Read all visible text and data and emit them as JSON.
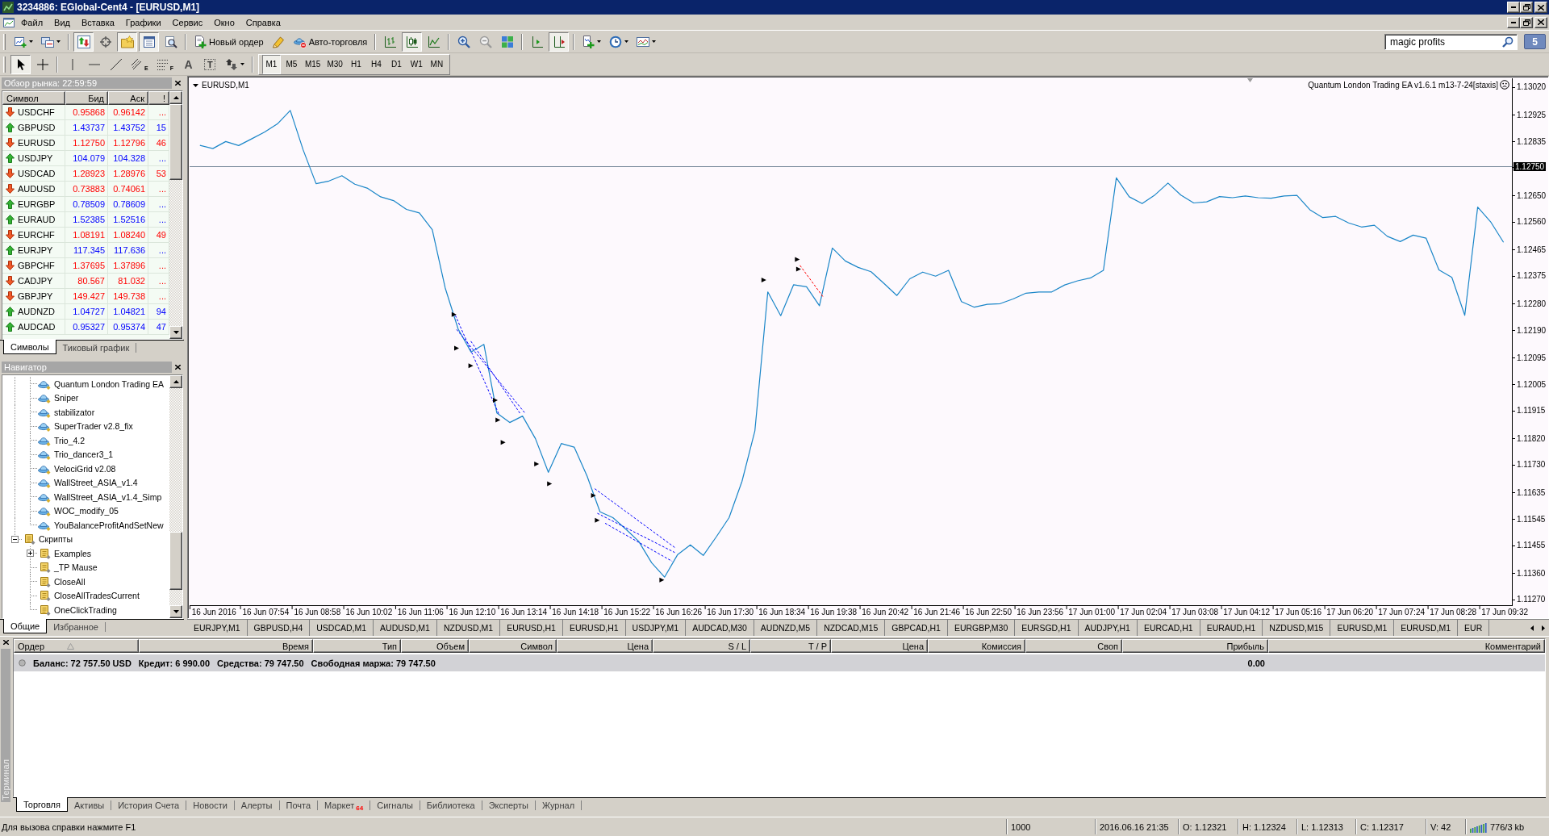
{
  "title_bar": {
    "title": "3234886: EGlobal-Cent4 - [EURUSD,M1]"
  },
  "menu": [
    "Файл",
    "Вид",
    "Вставка",
    "Графики",
    "Сервис",
    "Окно",
    "Справка"
  ],
  "toolbar": [
    [
      {
        "pressed": false
      },
      {
        "pressed": false
      }
    ],
    [
      {
        "pressed": true
      },
      {
        "pressed": false
      },
      {
        "pressed": true
      },
      {
        "pressed": true
      },
      {
        "pressed": false
      }
    ],
    [
      {
        "label": "Новый ордер",
        "pressed": false
      },
      {
        "pressed": false
      },
      {
        "label": "Авто-торговля",
        "pressed": false
      }
    ],
    [
      {
        "pressed": false
      },
      {
        "pressed": true
      },
      {
        "pressed": false
      }
    ],
    [
      {
        "pressed": false
      },
      {
        "pressed": false
      },
      {
        "pressed": false
      }
    ],
    [
      {
        "pressed": false
      },
      {
        "pressed": true
      }
    ],
    [
      {
        "pressed": false
      },
      {
        "pressed": false
      },
      {
        "pressed": false
      }
    ]
  ],
  "search": {
    "value": "magic profits"
  },
  "message_badge": "5",
  "drawing_tools": [
    [
      {
        "pressed": true
      },
      {
        "pressed": false
      }
    ],
    [
      {
        "pressed": false
      },
      {
        "pressed": false
      },
      {
        "pressed": false
      },
      {
        "pressed": false,
        "letter": "E"
      },
      {
        "pressed": false,
        "letter": "F"
      },
      {
        "pressed": false,
        "letter": "A"
      },
      {
        "pressed": false,
        "letter": "T"
      },
      {
        "pressed": false
      }
    ]
  ],
  "periods": [
    {
      "label": "M1",
      "selected": true
    },
    {
      "label": "M5",
      "selected": false
    },
    {
      "label": "M15",
      "selected": false
    },
    {
      "label": "M30",
      "selected": false
    },
    {
      "label": "H1",
      "selected": false
    },
    {
      "label": "H4",
      "selected": false
    },
    {
      "label": "D1",
      "selected": false
    },
    {
      "label": "W1",
      "selected": false
    },
    {
      "label": "MN",
      "selected": false
    }
  ],
  "market_watch": {
    "title": "Обзор рынка: 22:59:59",
    "columns": [
      "Символ",
      "Бид",
      "Аск",
      "!"
    ],
    "rows": [
      {
        "symbol": "USDCHF",
        "bid": "0.95868",
        "ask": "0.96142",
        "spread": "...",
        "up": false
      },
      {
        "symbol": "GBPUSD",
        "bid": "1.43737",
        "ask": "1.43752",
        "spread": "15",
        "up": true
      },
      {
        "symbol": "EURUSD",
        "bid": "1.12750",
        "ask": "1.12796",
        "spread": "46",
        "up": false
      },
      {
        "symbol": "USDJPY",
        "bid": "104.079",
        "ask": "104.328",
        "spread": "...",
        "up": true
      },
      {
        "symbol": "USDCAD",
        "bid": "1.28923",
        "ask": "1.28976",
        "spread": "53",
        "up": false
      },
      {
        "symbol": "AUDUSD",
        "bid": "0.73883",
        "ask": "0.74061",
        "spread": "...",
        "up": false
      },
      {
        "symbol": "EURGBP",
        "bid": "0.78509",
        "ask": "0.78609",
        "spread": "...",
        "up": true
      },
      {
        "symbol": "EURAUD",
        "bid": "1.52385",
        "ask": "1.52516",
        "spread": "...",
        "up": true
      },
      {
        "symbol": "EURCHF",
        "bid": "1.08191",
        "ask": "1.08240",
        "spread": "49",
        "up": false
      },
      {
        "symbol": "EURJPY",
        "bid": "117.345",
        "ask": "117.636",
        "spread": "...",
        "up": true
      },
      {
        "symbol": "GBPCHF",
        "bid": "1.37695",
        "ask": "1.37896",
        "spread": "...",
        "up": false
      },
      {
        "symbol": "CADJPY",
        "bid": "80.567",
        "ask": "81.032",
        "spread": "...",
        "up": false
      },
      {
        "symbol": "GBPJPY",
        "bid": "149.427",
        "ask": "149.738",
        "spread": "...",
        "up": false
      },
      {
        "symbol": "AUDNZD",
        "bid": "1.04727",
        "ask": "1.04821",
        "spread": "94",
        "up": true
      },
      {
        "symbol": "AUDCAD",
        "bid": "0.95327",
        "ask": "0.95374",
        "spread": "47",
        "up": true
      }
    ],
    "tabs": [
      {
        "label": "Символы",
        "selected": true
      },
      {
        "label": "Тиковый график",
        "selected": false
      }
    ]
  },
  "navigator": {
    "title": "Навигатор",
    "items": [
      {
        "children": [
          {
            "label": "Quantum London Trading EA",
            "kind": "expert"
          },
          {
            "label": "Sniper",
            "kind": "expert"
          },
          {
            "label": "stabilizator",
            "kind": "expert"
          },
          {
            "label": "SuperTrader v2.8_fix",
            "kind": "expert"
          },
          {
            "label": "Trio_4.2",
            "kind": "expert"
          },
          {
            "label": "Trio_dancer3_1",
            "kind": "expert"
          },
          {
            "label": "VelociGrid v2.08",
            "kind": "expert"
          },
          {
            "label": "WallStreet_ASIA_v1.4",
            "kind": "expert"
          },
          {
            "label": "WallStreet_ASIA_v1.4_Simp",
            "kind": "expert"
          },
          {
            "label": "WOC_modify_05",
            "kind": "expert"
          },
          {
            "label": "YouBalanceProfitAndSetNew",
            "kind": "expert"
          }
        ]
      },
      {
        "label": "Скрипты",
        "kind": "script",
        "expanded": true,
        "children": [
          {
            "label": "Examples",
            "kind": "script",
            "expanded": false
          },
          {
            "label": "_TP Mause",
            "kind": "script"
          },
          {
            "label": "CloseAll",
            "kind": "script"
          },
          {
            "label": "CloseAllTradesCurrent",
            "kind": "script"
          },
          {
            "label": "OneClickTrading",
            "kind": "script"
          }
        ]
      }
    ],
    "tabs": [
      {
        "label": "Общие",
        "selected": true
      },
      {
        "label": "Избранное",
        "selected": false
      }
    ]
  },
  "chart": {
    "symbol_label": "EURUSD,M1",
    "ea_label": "Quantum London Trading EA v1.6.1 m13-7-24[staxis]",
    "chart_data": [
      {
        "type": "line",
        "color": "#1a86c8",
        "ylim": [
          1.1125,
          1.1305
        ],
        "yticks": [
          {
            "value": 1.1302,
            "label": "1.13020"
          },
          {
            "value": 1.12925,
            "label": "1.12925"
          },
          {
            "value": 1.12835,
            "label": "1.12835"
          },
          {
            "value": 1.1265,
            "label": "1.12650"
          },
          {
            "value": 1.1256,
            "label": "1.12560"
          },
          {
            "value": 1.12465,
            "label": "1.12465"
          },
          {
            "value": 1.12375,
            "label": "1.12375"
          },
          {
            "value": 1.1228,
            "label": "1.12280"
          },
          {
            "value": 1.1219,
            "label": "1.12190"
          },
          {
            "value": 1.12095,
            "label": "1.12095"
          },
          {
            "value": 1.12005,
            "label": "1.12005"
          },
          {
            "value": 1.11915,
            "label": "1.11915"
          },
          {
            "value": 1.1182,
            "label": "1.11820"
          },
          {
            "value": 1.1173,
            "label": "1.11730"
          },
          {
            "value": 1.11635,
            "label": "1.11635"
          },
          {
            "value": 1.11545,
            "label": "1.11545"
          },
          {
            "value": 1.11455,
            "label": "1.11455"
          },
          {
            "value": 1.1136,
            "label": "1.11360"
          },
          {
            "value": 1.1127,
            "label": "1.11270"
          }
        ],
        "ref_lines": [
          {
            "axis": "y",
            "value": 1.1275,
            "label": "1.12750",
            "color": "#778899"
          }
        ],
        "categories": [
          null,
          "16 Jun 2016",
          null,
          null,
          null,
          "16 Jun 07:54",
          null,
          null,
          null,
          "16 Jun 08:58",
          null,
          null,
          null,
          "16 Jun 10:02",
          null,
          null,
          null,
          "16 Jun 11:06",
          null,
          null,
          null,
          "16 Jun 12:10",
          null,
          null,
          null,
          "16 Jun 13:14",
          null,
          null,
          null,
          "16 Jun 14:18",
          null,
          null,
          null,
          "16 Jun 15:22",
          null,
          null,
          null,
          "16 Jun 16:26",
          null,
          null,
          null,
          "16 Jun 17:30",
          null,
          null,
          null,
          "16 Jun 18:34",
          null,
          null,
          null,
          "16 Jun 19:38",
          null,
          null,
          null,
          "16 Jun 20:42",
          null,
          null,
          null,
          "16 Jun 21:46",
          null,
          null,
          null,
          "16 Jun 22:50",
          null,
          null,
          null,
          "16 Jun 23:56",
          null,
          null,
          null,
          "17 Jun 01:00",
          null,
          null,
          null,
          "17 Jun 02:04",
          null,
          null,
          null,
          "17 Jun 03:08",
          null,
          null,
          null,
          "17 Jun 04:12",
          null,
          null,
          null,
          "17 Jun 05:16",
          null,
          null,
          null,
          "17 Jun 06:20",
          null,
          null,
          null,
          "17 Jun 07:24",
          null,
          null,
          null,
          "17 Jun 08:28",
          null,
          null,
          null,
          "17 Jun 09:32"
        ],
        "values": [
          1.12821,
          1.1281,
          1.12834,
          1.1282,
          1.12843,
          1.12866,
          1.12894,
          1.1294,
          1.12805,
          1.1269,
          1.12699,
          1.12717,
          1.12688,
          1.12674,
          1.12645,
          1.12632,
          1.12602,
          1.1259,
          1.12533,
          1.12334,
          1.12194,
          1.12115,
          1.12141,
          1.11907,
          1.11874,
          1.11896,
          1.11819,
          1.11704,
          1.11802,
          1.1179,
          1.11691,
          1.11569,
          1.11549,
          1.1151,
          1.11468,
          1.11395,
          1.11346,
          1.11422,
          1.11456,
          1.1142,
          1.11483,
          1.11549,
          1.11673,
          1.11846,
          1.1232,
          1.12239,
          1.12345,
          1.12338,
          1.12273,
          1.1247,
          1.12426,
          1.12404,
          1.12389,
          1.12349,
          1.12308,
          1.12365,
          1.12388,
          1.12374,
          1.12394,
          1.12287,
          1.12268,
          1.12278,
          1.1228,
          1.12296,
          1.12316,
          1.1232,
          1.1232,
          1.12344,
          1.12358,
          1.12368,
          1.12394,
          1.1271,
          1.12645,
          1.12622,
          1.12652,
          1.12692,
          1.12651,
          1.12624,
          1.12628,
          1.12646,
          1.12642,
          1.12648,
          1.12642,
          1.1264,
          1.12648,
          1.1265,
          1.12601,
          1.12574,
          1.12578,
          1.12556,
          1.12542,
          1.12548,
          1.1251,
          1.12492,
          1.12514,
          1.12504,
          1.12395,
          1.1237,
          1.1224,
          1.1261,
          1.1256,
          1.1249
        ]
      }
    ],
    "symbol_tabs": [
      {
        "label": "EURJPY,M1",
        "selected": false
      },
      {
        "label": "GBPUSD,H4",
        "selected": false
      },
      {
        "label": "USDCAD,M1",
        "selected": false
      },
      {
        "label": "AUDUSD,M1",
        "selected": false
      },
      {
        "label": "NZDUSD,M1",
        "selected": false
      },
      {
        "label": "EURUSD,H1",
        "selected": false
      },
      {
        "label": "EURUSD,H1",
        "selected": false
      },
      {
        "label": "USDJPY,M1",
        "selected": false
      },
      {
        "label": "AUDCAD,M30",
        "selected": false
      },
      {
        "label": "AUDNZD,M5",
        "selected": false
      },
      {
        "label": "NZDCAD,M15",
        "selected": false
      },
      {
        "label": "GBPCAD,H1",
        "selected": false
      },
      {
        "label": "EURGBP,M30",
        "selected": false
      },
      {
        "label": "EURSGD,H1",
        "selected": false
      },
      {
        "label": "AUDJPY,H1",
        "selected": false
      },
      {
        "label": "EURCAD,H1",
        "selected": false
      },
      {
        "label": "EURAUD,H1",
        "selected": false
      },
      {
        "label": "NZDUSD,M15",
        "selected": false
      },
      {
        "label": "EURUSD,M1",
        "selected": false
      },
      {
        "label": "EURUSD,M1",
        "selected": false
      },
      {
        "label": "EUR",
        "selected": false
      }
    ]
  },
  "terminal": {
    "title": "Терминал",
    "columns": [
      {
        "label": "Ордер",
        "sorted": true
      },
      {
        "label": "Время",
        "sorted": false
      },
      {
        "label": "Тип",
        "sorted": false
      },
      {
        "label": "Объем",
        "sorted": false
      },
      {
        "label": "Символ",
        "sorted": false
      },
      {
        "label": "Цена",
        "sorted": false
      },
      {
        "label": "S / L",
        "sorted": false
      },
      {
        "label": "T / P",
        "sorted": false
      },
      {
        "label": "Цена",
        "sorted": false
      },
      {
        "label": "Комиссия",
        "sorted": false
      },
      {
        "label": "Своп",
        "sorted": false
      },
      {
        "label": "Прибыль",
        "sorted": false
      },
      {
        "label": "Комментарий",
        "sorted": false
      }
    ],
    "summary": [
      "Баланс: 72 757.50 USD",
      "Кредит: 6 990.00",
      "Средства: 79 747.50",
      "Свободная маржа: 79 747.50"
    ],
    "profit": "0.00",
    "tabs": [
      {
        "label": "Торговля",
        "selected": true
      },
      {
        "label": "Активы",
        "selected": false
      },
      {
        "label": "История Счета",
        "selected": false
      },
      {
        "label": "Новости",
        "selected": false
      },
      {
        "label": "Алерты",
        "selected": false
      },
      {
        "label": "Почта",
        "selected": false
      },
      {
        "label": "Маркет",
        "badge": "64",
        "selected": false
      },
      {
        "label": "Сигналы",
        "selected": false
      },
      {
        "label": "Библиотека",
        "selected": false
      },
      {
        "label": "Эксперты",
        "selected": false
      },
      {
        "label": "Журнал",
        "selected": false
      }
    ]
  },
  "status_bar": {
    "help": "Для вызова справки нажмите F1",
    "fields": [
      "1000",
      "2016.06.16 21:35",
      "O: 1.12321",
      "H: 1.12324",
      "L: 1.12313",
      "C: 1.12317",
      "V: 42"
    ],
    "traffic": "776/3 kb"
  }
}
